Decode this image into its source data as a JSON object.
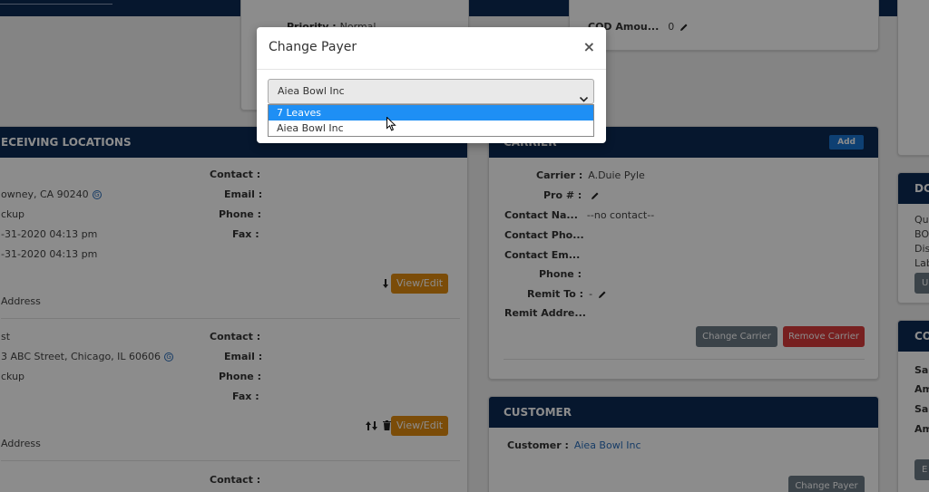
{
  "top_summary": {
    "priority_label": "Priority :",
    "priority_value": "Normal",
    "cod_label": "COD Amou...",
    "cod_value": "0"
  },
  "locations": {
    "title": "ECEIVING LOCATIONS",
    "stops": [
      {
        "address": "owney, CA 90240",
        "type": "ckup",
        "time1": "-31-2020 04:13 pm",
        "time2": "-31-2020 04:13 pm",
        "address_label": "Address",
        "contact_label": "Contact :",
        "email_label": "Email :",
        "phone_label": "Phone :",
        "fax_label": "Fax :",
        "view_edit_label": "View/Edit"
      },
      {
        "name": "st",
        "address": "3 ABC Street, Chicago, IL 60606",
        "type": "ckup",
        "address_label": "Address",
        "contact_label": "Contact :",
        "email_label": "Email :",
        "phone_label": "Phone :",
        "fax_label": "Fax :",
        "view_edit_label": "View/Edit"
      },
      {
        "contact_label": "Contact :"
      }
    ]
  },
  "carrier": {
    "title": "CARRIER",
    "add_label": "Add",
    "carrier_label": "Carrier :",
    "carrier_value": "A.Duie Pyle",
    "pro_label": "Pro # :",
    "contact_name_label": "Contact Na...",
    "contact_name_value": "--no contact--",
    "contact_phone_label": "Contact Pho...",
    "contact_email_label": "Contact Em...",
    "phone_label": "Phone :",
    "remit_to_label": "Remit To :",
    "remit_to_value": "-",
    "remit_address_label": "Remit Addre...",
    "change_carrier_label": "Change Carrier",
    "remove_carrier_label": "Remove Carrier"
  },
  "customer": {
    "title": "CUSTOMER",
    "customer_label": "Customer :",
    "customer_value": "Aiea Bowl Inc",
    "change_payer_label": "Change Payer"
  },
  "right_docs": {
    "title": "DC",
    "lines": [
      "Qu",
      "BO",
      "Dis",
      "Lab"
    ],
    "button_label": "U"
  },
  "right_co": {
    "title": "CO",
    "lines": [
      "Sal",
      "Am",
      "Sal",
      "Am"
    ],
    "button_label": "E"
  },
  "modal": {
    "title": "Change Payer",
    "close_glyph": "×",
    "selected_value": "Aiea Bowl Inc",
    "options": [
      "7 Leaves",
      "Aiea Bowl Inc"
    ]
  },
  "colors": {
    "navy": "#0b2a55",
    "orange": "#e08a10",
    "highlight": "#1e8ff5",
    "red": "#d93b3b"
  }
}
